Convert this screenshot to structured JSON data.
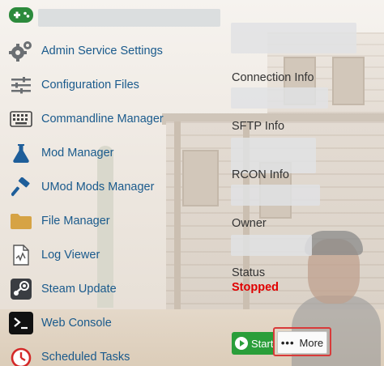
{
  "app": {
    "logo_icon": "gamepad-icon",
    "brand_color": "#2c8a3c"
  },
  "sidebar": {
    "items": [
      {
        "label": "Admin Service Settings",
        "icon": "gears-icon"
      },
      {
        "label": "Configuration Files",
        "icon": "sliders-icon"
      },
      {
        "label": "Commandline Manager",
        "icon": "keyboard-icon"
      },
      {
        "label": "Mod Manager",
        "icon": "flask-icon"
      },
      {
        "label": "UMod Mods Manager",
        "icon": "hammer-icon"
      },
      {
        "label": "File Manager",
        "icon": "folder-icon"
      },
      {
        "label": "Log Viewer",
        "icon": "log-file-icon"
      },
      {
        "label": "Steam Update",
        "icon": "steam-icon"
      },
      {
        "label": "Web Console",
        "icon": "terminal-icon"
      },
      {
        "label": "Scheduled Tasks",
        "icon": "clock-icon"
      }
    ],
    "link_color": "#1a5a8c"
  },
  "info": {
    "connection_label": "Connection Info",
    "sftp_label": "SFTP Info",
    "rcon_label": "RCON Info",
    "owner_label": "Owner",
    "status_label": "Status",
    "status_value": "Stopped",
    "status_color": "#e00000"
  },
  "actions": {
    "start_label": "Start",
    "more_label": "More",
    "start_color": "#2a9e3a",
    "highlight_color": "#d83a3a"
  }
}
